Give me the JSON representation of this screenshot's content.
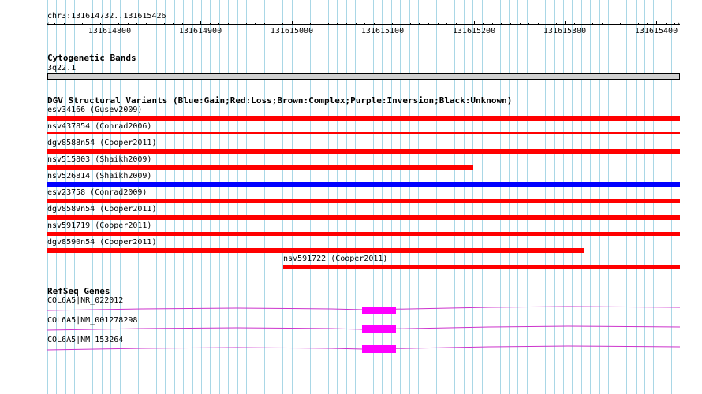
{
  "ruler": {
    "range_label": "chr3:131614732..131615426",
    "ticks": [
      "131614800",
      "131614900",
      "131615000",
      "131615100",
      "131615200",
      "131615300",
      "131615400"
    ]
  },
  "cytoband": {
    "title": "Cytogenetic Bands",
    "band_label": "3q22.1"
  },
  "dgv": {
    "title": "DGV Structural Variants (Blue:Gain;Red:Loss;Brown:Complex;Purple:Inversion;Black:Unknown)",
    "colors": {
      "gain": "#0000ff",
      "loss": "#ff0000"
    },
    "variants": [
      {
        "label": "esv34166 (Gusev2009)",
        "type": "loss"
      },
      {
        "label": "nsv437854 (Conrad2006)",
        "type": "loss"
      },
      {
        "label": "dgv8588n54 (Cooper2011)",
        "type": "loss"
      },
      {
        "label": "nsv515803 (Shaikh2009)",
        "type": "loss"
      },
      {
        "label": "nsv526814 (Shaikh2009)",
        "type": "gain"
      },
      {
        "label": "esv23758 (Conrad2009)",
        "type": "loss"
      },
      {
        "label": "dgv8589n54 (Cooper2011)",
        "type": "loss"
      },
      {
        "label": "nsv591719 (Cooper2011)",
        "type": "loss"
      },
      {
        "label": "dgv8590n54 (Cooper2011)",
        "type": "loss"
      },
      {
        "label": "nsv591722 (Cooper2011)",
        "type": "loss"
      }
    ]
  },
  "refseq": {
    "title": "RefSeq Genes",
    "color": "#ff00ff",
    "genes": [
      {
        "label": "COL6A5|NR_022012"
      },
      {
        "label": "COL6A5|NM_001278298"
      },
      {
        "label": "COL6A5|NM_153264"
      }
    ]
  }
}
